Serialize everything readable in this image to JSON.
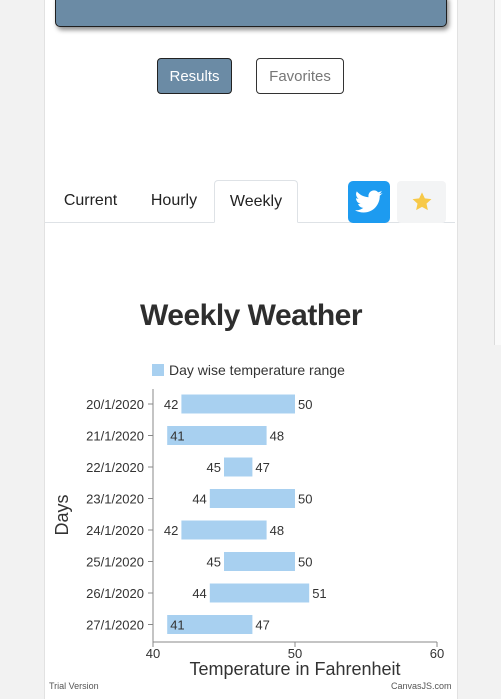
{
  "buttons": {
    "results": "Results",
    "favorites": "Favorites"
  },
  "tabs": [
    "Current",
    "Hourly",
    "Weekly"
  ],
  "active_tab": "Weekly",
  "icons": {
    "twitter": "twitter-icon",
    "favorite": "star-icon"
  },
  "colors": {
    "accent": "#6b8ba5",
    "twitter": "#1d9bf0",
    "star": "#f7c948",
    "bar": "#a8d0f0"
  },
  "chart_data": {
    "type": "bar",
    "orientation": "horizontal",
    "range_bars": true,
    "title": "Weekly Weather",
    "xlabel": "Temperature in Fahrenheit",
    "ylabel": "Days",
    "legend": "Day wise temperature range",
    "xlim": [
      40,
      60
    ],
    "xticks": [
      "40",
      "50",
      "60"
    ],
    "categories": [
      "20/1/2020",
      "21/1/2020",
      "22/1/2020",
      "23/1/2020",
      "24/1/2020",
      "25/1/2020",
      "26/1/2020",
      "27/1/2020"
    ],
    "values": [
      [
        42,
        50
      ],
      [
        41,
        48
      ],
      [
        45,
        47
      ],
      [
        44,
        50
      ],
      [
        42,
        48
      ],
      [
        45,
        50
      ],
      [
        44,
        51
      ],
      [
        41,
        47
      ]
    ],
    "low_labels": [
      "42",
      "41",
      "45",
      "44",
      "42",
      "45",
      "44",
      "41"
    ],
    "high_labels": [
      "50",
      "48",
      "47",
      "50",
      "48",
      "50",
      "51",
      "47"
    ],
    "grid": false,
    "legend_position": "top"
  },
  "credits": {
    "left": "Trial Version",
    "right": "CanvasJS.com"
  }
}
